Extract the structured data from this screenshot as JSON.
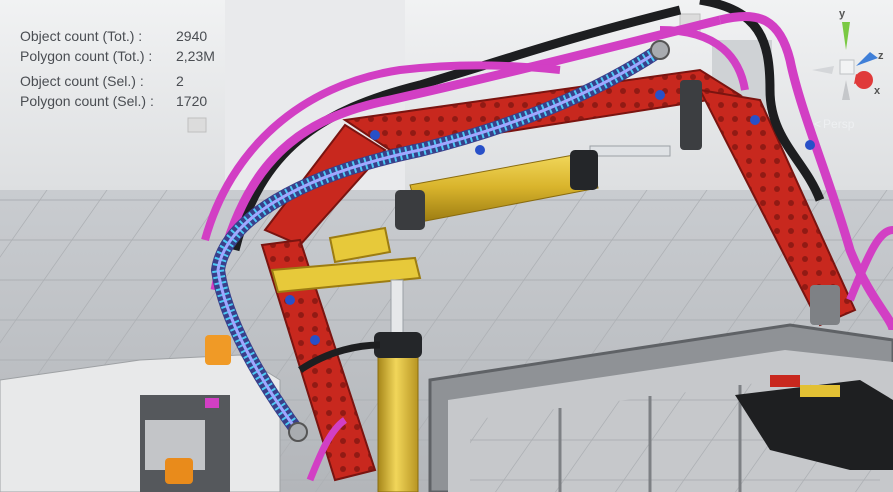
{
  "stats": {
    "obj_tot_label": "Object count (Tot.) :",
    "obj_tot_value": "2940",
    "poly_tot_label": "Polygon count (Tot.) :",
    "poly_tot_value": "2,23M",
    "obj_sel_label": "Object count (Sel.) :",
    "obj_sel_value": "2",
    "poly_sel_label": "Polygon count (Sel.) :",
    "poly_sel_value": "1720"
  },
  "gizmo": {
    "y_label": "y",
    "z_label": "z",
    "x_label": "x",
    "projection_label": "Persp",
    "colors": {
      "y": "#7ac943",
      "z": "#3f7fd8",
      "x": "#e03a3a"
    }
  },
  "scene": {
    "description_icons": [
      "lego-excavator-model",
      "hose-selection-highlight"
    ],
    "colors": {
      "beam": "#c8281e",
      "hose_magenta": "#d23fc4",
      "hose_black": "#222222",
      "cylinder": "#e2c034",
      "selection": "#4fd8ff"
    }
  }
}
